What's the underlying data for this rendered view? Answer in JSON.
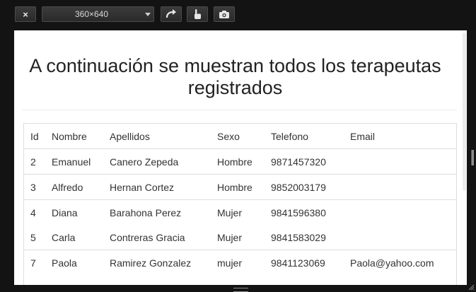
{
  "toolbar": {
    "close_label": "×",
    "device_size": "360×640"
  },
  "page": {
    "heading": "A continuación se muestran todos los terapeutas registrados"
  },
  "table": {
    "headers": [
      "Id",
      "Nombre",
      "Apellidos",
      "Sexo",
      "Telefono",
      "Email"
    ],
    "rows": [
      [
        "2",
        "Emanuel",
        "Canero Zepeda",
        "Hombre",
        "9871457320",
        ""
      ],
      [
        "3",
        "Alfredo",
        "Hernan Cortez",
        "Hombre",
        "9852003179",
        ""
      ],
      [
        "4",
        "Diana",
        "Barahona Perez",
        "Mujer",
        "9841596380",
        ""
      ],
      [
        "5",
        "Carla",
        "Contreras Gracia",
        "Mujer",
        "9841583029",
        ""
      ],
      [
        "7",
        "Paola",
        "Ramirez Gonzalez",
        "mujer",
        "9841123069",
        "Paola@yahoo.com"
      ]
    ]
  }
}
